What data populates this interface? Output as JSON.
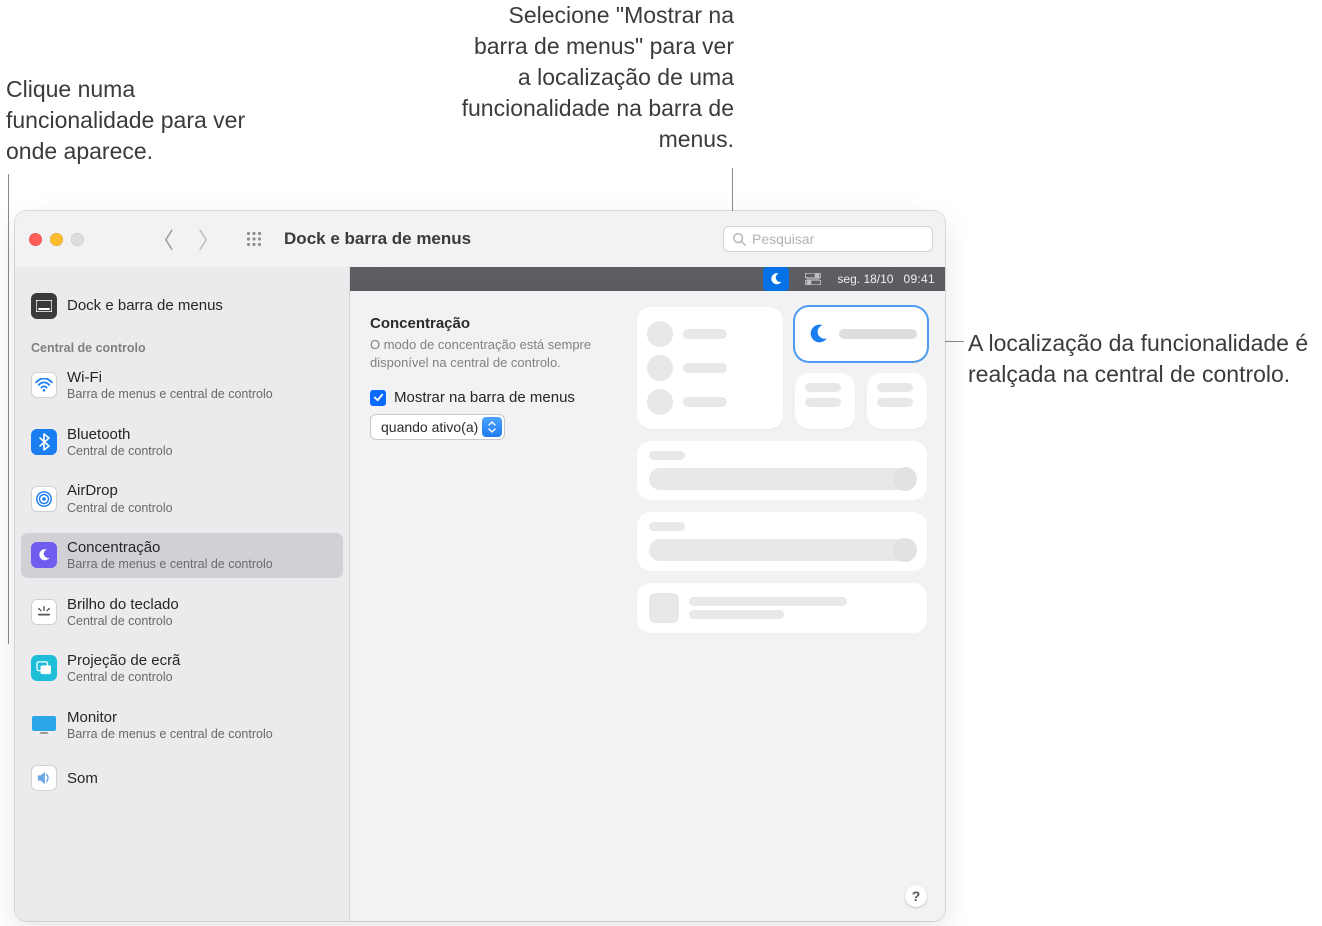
{
  "callouts": {
    "left": "Clique numa funcionalidade para ver onde aparece.",
    "top": "Selecione \"Mostrar na barra de menus\" para ver a localização de uma funcionalidade na barra de menus.",
    "right": "A localização da funcionalidade é realçada na central de controlo."
  },
  "toolbar": {
    "title": "Dock e barra de menus",
    "search_placeholder": "Pesquisar"
  },
  "sidebar": {
    "dock_label": "Dock e barra de menus",
    "section_header": "Central de controlo",
    "items": [
      {
        "id": "wifi",
        "title": "Wi-Fi",
        "sub": "Barra de menus e central de controlo",
        "selected": false
      },
      {
        "id": "bt",
        "title": "Bluetooth",
        "sub": "Central de controlo",
        "selected": false
      },
      {
        "id": "airdrop",
        "title": "AirDrop",
        "sub": "Central de controlo",
        "selected": false
      },
      {
        "id": "focus",
        "title": "Concentração",
        "sub": "Barra de menus e central de controlo",
        "selected": true
      },
      {
        "id": "kbbright",
        "title": "Brilho do teclado",
        "sub": "Central de controlo",
        "selected": false
      },
      {
        "id": "mirror",
        "title": "Projeção de ecrã",
        "sub": "Central de controlo",
        "selected": false
      },
      {
        "id": "display",
        "title": "Monitor",
        "sub": "Barra de menus e central de controlo",
        "selected": false
      },
      {
        "id": "sound",
        "title": "Som",
        "sub": "",
        "selected": false
      }
    ]
  },
  "detail": {
    "title": "Concentração",
    "desc": "O modo de concentração está sempre disponível na central de controlo.",
    "checkbox_label": "Mostrar na barra de menus",
    "checkbox_checked": true,
    "select_value": "quando ativo(a)"
  },
  "menubar_preview": {
    "date": "seg. 18/10",
    "time": "09:41"
  },
  "help_label": "?"
}
